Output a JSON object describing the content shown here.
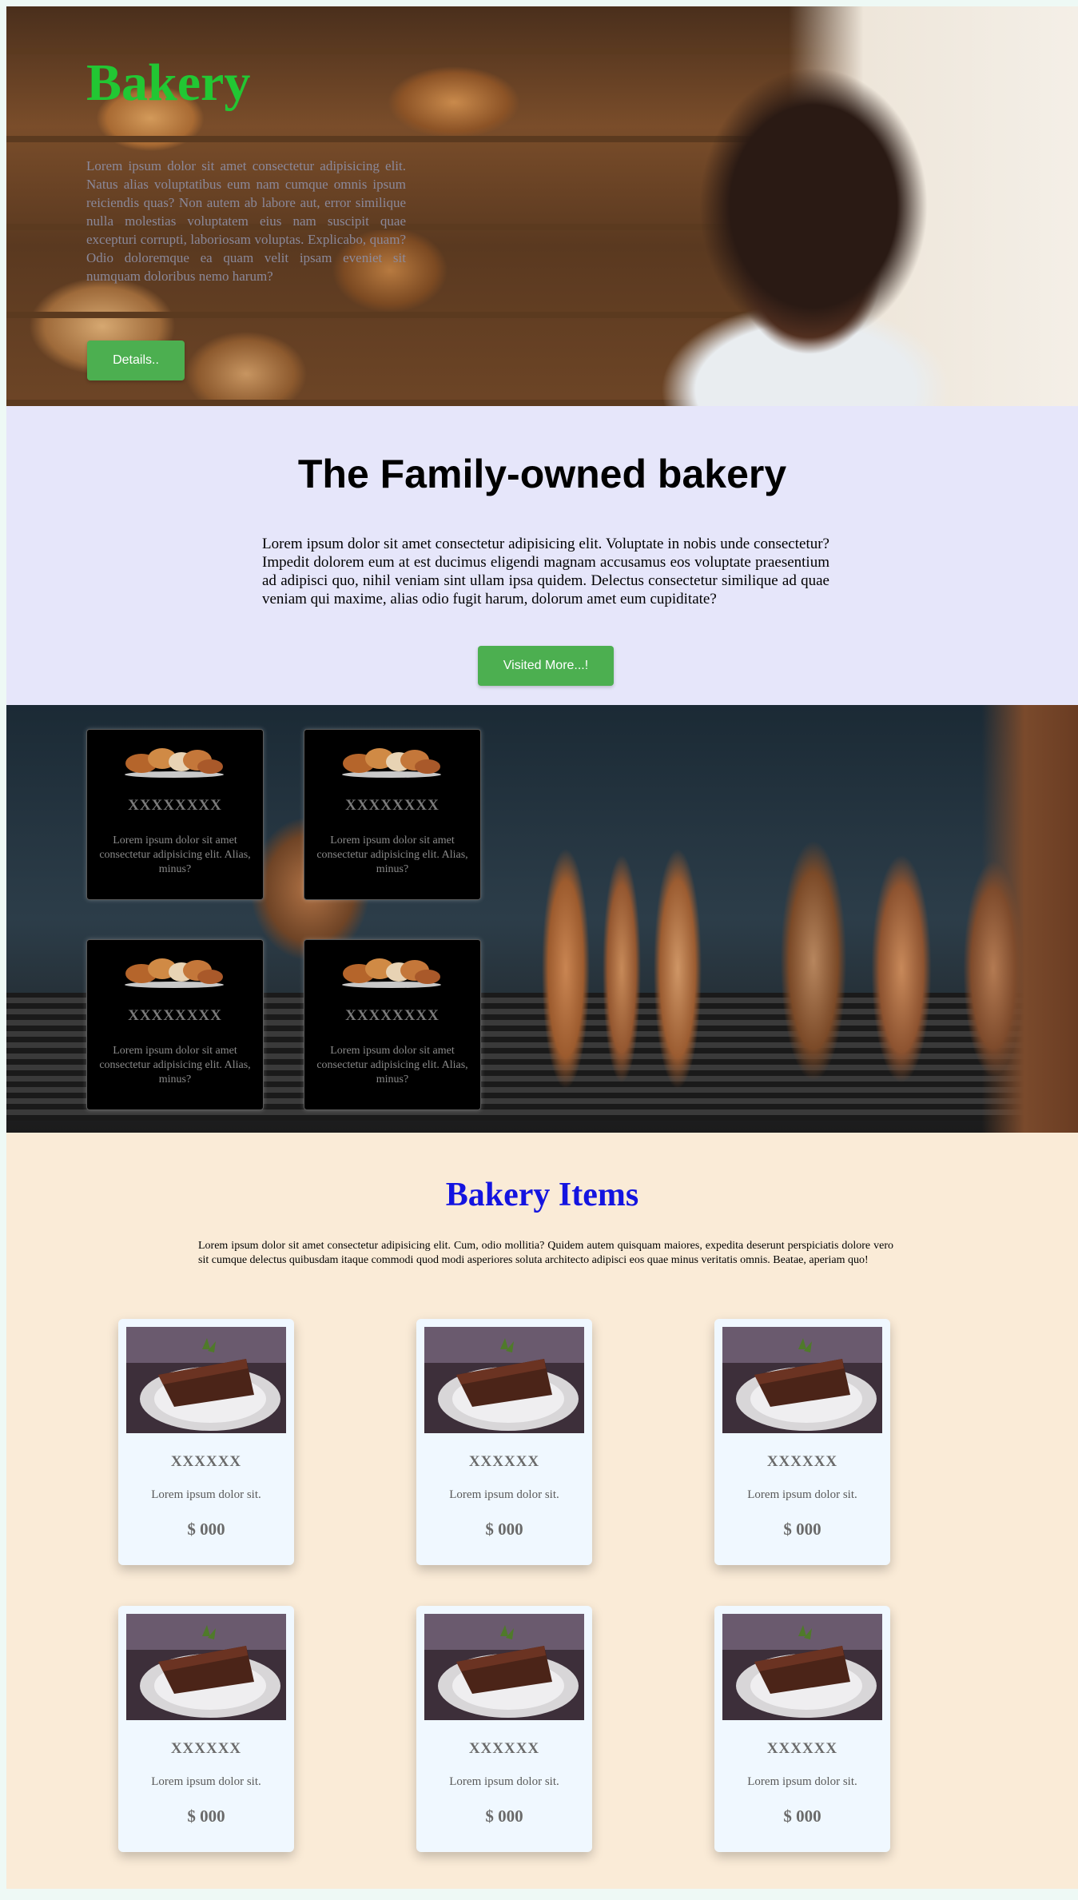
{
  "hero": {
    "title": "Bakery",
    "text": "Lorem ipsum dolor sit amet consectetur adipisicing elit. Natus alias voluptatibus eum nam cumque omnis ipsum reiciendis quas? Non autem ab labore aut, error similique nulla molestias voluptatem eius nam suscipit quae excepturi corrupti, laboriosam voluptas. Explicabo, quam? Odio doloremque ea quam velit ipsam eveniet sit numquam doloribus nemo harum?",
    "button_label": "Details.."
  },
  "about": {
    "title": "The Family-owned bakery",
    "text": "Lorem ipsum dolor sit amet consectetur adipisicing elit. Voluptate in nobis unde consectetur? Impedit dolorem eum at est ducimus eligendi magnam accusamus eos voluptate praesentium ad adipisci quo, nihil veniam sint ullam ipsa quidem. Delectus consectetur similique ad quae veniam qui maxime, alias odio fugit harum, dolorum amet eum cupiditate?",
    "button_label": "Visited More...!"
  },
  "menu_cards": [
    {
      "title": "XXXXXXXX",
      "text": "Lorem ipsum dolor sit amet consectetur adipisicing elit. Alias, minus?"
    },
    {
      "title": "XXXXXXXX",
      "text": "Lorem ipsum dolor sit amet consectetur adipisicing elit. Alias, minus?"
    },
    {
      "title": "XXXXXXXX",
      "text": "Lorem ipsum dolor sit amet consectetur adipisicing elit. Alias, minus?"
    },
    {
      "title": "XXXXXXXX",
      "text": "Lorem ipsum dolor sit amet consectetur adipisicing elit. Alias, minus?"
    }
  ],
  "items": {
    "title": "Bakery Items",
    "text": "Lorem ipsum dolor sit amet consectetur adipisicing elit. Cum, odio mollitia? Quidem autem quisquam maiores, expedita deserunt perspiciatis dolore vero sit cumque delectus quibusdam itaque commodi quod modi asperiores soluta architecto adipisci eos quae minus veritatis omnis. Beatae, aperiam quo!",
    "cards": [
      {
        "name": "XXXXXX",
        "desc": "Lorem ipsum dolor sit.",
        "price": "$ 000"
      },
      {
        "name": "XXXXXX",
        "desc": "Lorem ipsum dolor sit.",
        "price": "$ 000"
      },
      {
        "name": "XXXXXX",
        "desc": "Lorem ipsum dolor sit.",
        "price": "$ 000"
      },
      {
        "name": "XXXXXX",
        "desc": "Lorem ipsum dolor sit.",
        "price": "$ 000"
      },
      {
        "name": "XXXXXX",
        "desc": "Lorem ipsum dolor sit.",
        "price": "$ 000"
      },
      {
        "name": "XXXXXX",
        "desc": "Lorem ipsum dolor sit.",
        "price": "$ 000"
      }
    ]
  },
  "colors": {
    "hero_title": "#22c733",
    "button": "#4caf50",
    "about_bg": "#e6e6fa",
    "items_bg": "#faebd7",
    "items_title": "#1414e0",
    "card_bg": "#f0f8ff"
  }
}
